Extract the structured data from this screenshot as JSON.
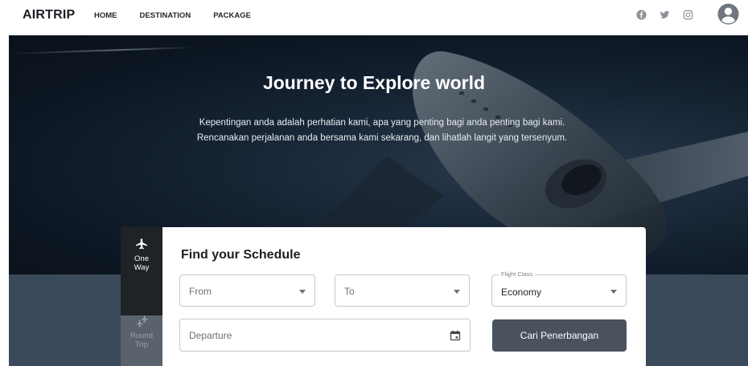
{
  "header": {
    "brand": "AIRTRIP",
    "nav": [
      {
        "label": "HOME"
      },
      {
        "label": "DESTINATION"
      },
      {
        "label": "PACKAGE"
      }
    ],
    "social_icons": [
      "facebook-icon",
      "twitter-icon",
      "instagram-icon"
    ],
    "avatar_icon": "user-avatar-icon"
  },
  "hero": {
    "title": "Journey to Explore world",
    "description": "Kepentingan anda adalah perhatian kami, apa yang penting bagi anda penting bagi kami. Rencanakan perjalanan anda bersama kami sekarang, dan lihatlah langit yang tersenyum."
  },
  "trip_types": [
    {
      "label_line1": "One",
      "label_line2": "Way",
      "icon": "airplane-icon",
      "active": true
    },
    {
      "label_line1": "Round",
      "label_line2": "Trip",
      "icon": "connecting-airports-icon",
      "active": false
    }
  ],
  "search": {
    "title": "Find your Schedule",
    "from": {
      "placeholder": "From"
    },
    "to": {
      "placeholder": "To"
    },
    "flight_class": {
      "label": "Flight Class",
      "value": "Economy"
    },
    "departure": {
      "placeholder": "Departure"
    },
    "submit_label": "Cari Penerbangan"
  },
  "colors": {
    "hero_dark": "#0c1622",
    "lower_band": "#3b4a5a",
    "tab_active": "#1f2227",
    "tab_inactive": "#59626d",
    "button": "#49525d"
  }
}
